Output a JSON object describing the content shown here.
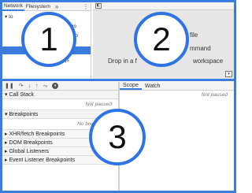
{
  "navigator": {
    "tabs": [
      "Network",
      "Filesystem"
    ],
    "more": "»",
    "menu": "⋮",
    "tree": [
      "▾ to",
      "ub.io",
      "s/deb",
      "",
      "js"
    ]
  },
  "editor": {
    "toggle": "◧",
    "hints": [
      "file",
      "mmand",
      "Drop in a f",
      "workspace"
    ],
    "corner": "▾"
  },
  "debugger": {
    "toolbar": [
      "❚❚",
      "↷",
      "↓",
      "↑",
      "⤳",
      "⏸"
    ],
    "sections": [
      {
        "label": "▾ Call Stack",
        "body": "Not paused"
      },
      {
        "label": "▾ Breakpoints",
        "body": "No breakpoints"
      },
      {
        "label": "▸ XHR/fetch Breakpoints"
      },
      {
        "label": "▸ DOM Breakpoints"
      },
      {
        "label": "▸ Global Listeners"
      },
      {
        "label": "▸ Event Listener Breakpoints"
      }
    ]
  },
  "scope": {
    "tabs": [
      "Scope",
      "Watch"
    ],
    "status": "Not paused"
  },
  "callouts": [
    "1",
    "2",
    "3"
  ]
}
